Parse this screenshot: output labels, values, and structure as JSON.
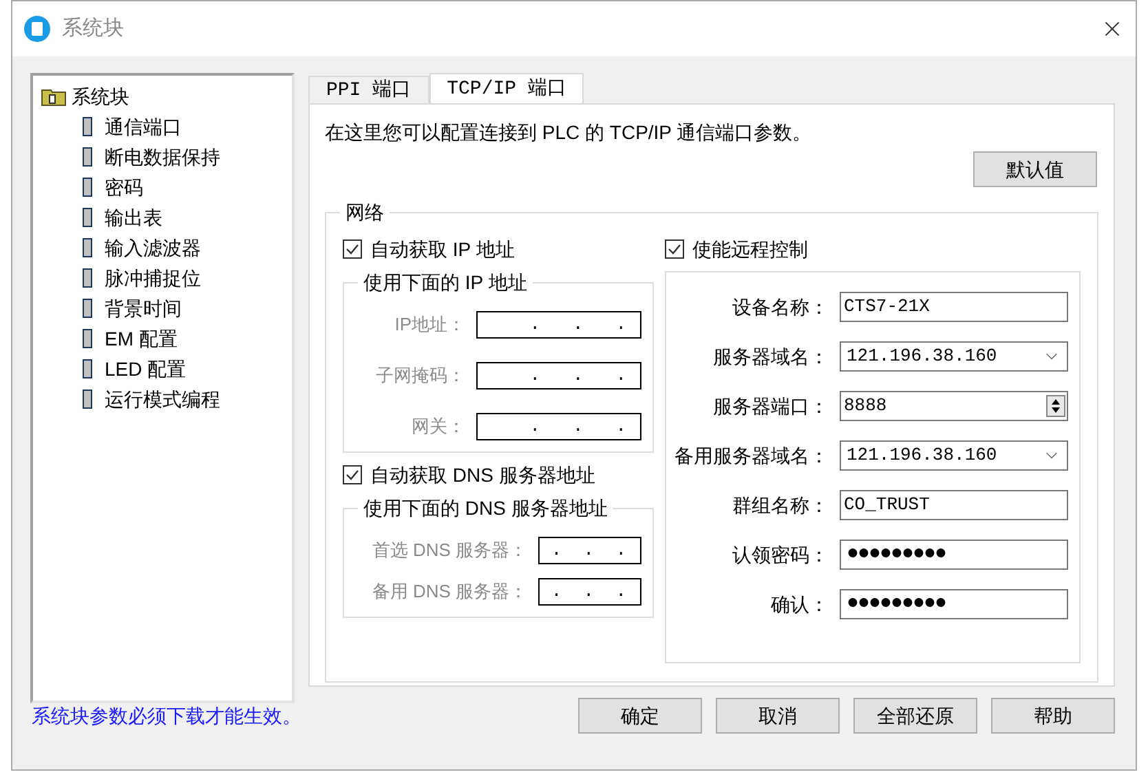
{
  "window": {
    "title": "系统块"
  },
  "tree": {
    "label": "系统块",
    "children": [
      {
        "label": "通信端口",
        "selected": false
      },
      {
        "label": "断电数据保持",
        "selected": false
      },
      {
        "label": "密码",
        "selected": false
      },
      {
        "label": "输出表",
        "selected": false
      },
      {
        "label": "输入滤波器",
        "selected": false
      },
      {
        "label": "脉冲捕捉位",
        "selected": false
      },
      {
        "label": "背景时间",
        "selected": false
      },
      {
        "label": "EM 配置",
        "selected": false
      },
      {
        "label": "LED 配置",
        "selected": false
      },
      {
        "label": "运行模式编程",
        "selected": false
      }
    ]
  },
  "tabs": [
    {
      "label": "PPI 端口",
      "selected": false
    },
    {
      "label": "TCP/IP 端口",
      "selected": true
    }
  ],
  "description": "在这里您可以配置连接到 PLC 的 TCP/IP 通信端口参数。",
  "default_button": "默认值",
  "network": {
    "title": "网络",
    "auto_ip": {
      "label": "自动获取 IP 地址",
      "checked": true
    },
    "manual_ip": {
      "title": "使用下面的 IP 地址",
      "disabled": true,
      "fields": [
        {
          "label": "IP地址：",
          "value": ".   .   ."
        },
        {
          "label": "子网掩码：",
          "value": ".   .   ."
        },
        {
          "label": "网关：",
          "value": ".   .   ."
        }
      ]
    },
    "auto_dns": {
      "label": "自动获取 DNS 服务器地址",
      "checked": true
    },
    "manual_dns": {
      "title": "使用下面的 DNS 服务器地址",
      "disabled": true,
      "fields": [
        {
          "label": "首选 DNS 服务器：",
          "value": ".  .  ."
        },
        {
          "label": "备用 DNS 服务器：",
          "value": ".  .  ."
        }
      ]
    },
    "remote": {
      "label": "使能远程控制",
      "checked": true,
      "fields": [
        {
          "kind": "text",
          "label": "设备名称：",
          "value": "CTS7-21X"
        },
        {
          "kind": "combo",
          "label": "服务器域名：",
          "value": "121.196.38.160"
        },
        {
          "kind": "spin",
          "label": "服务器端口：",
          "value": "8888"
        },
        {
          "kind": "combo",
          "label": "备用服务器域名：",
          "value": "121.196.38.160"
        },
        {
          "kind": "text",
          "label": "群组名称：",
          "value": "CO_TRUST"
        },
        {
          "kind": "password",
          "label": "认领密码：",
          "value": "●●●●●●●●●"
        },
        {
          "kind": "password",
          "label": "确认：",
          "value": "●●●●●●●●●"
        }
      ]
    }
  },
  "footer_note": "系统块参数必须下载才能生效。",
  "buttons": [
    "确定",
    "取消",
    "全部还原",
    "帮助"
  ]
}
